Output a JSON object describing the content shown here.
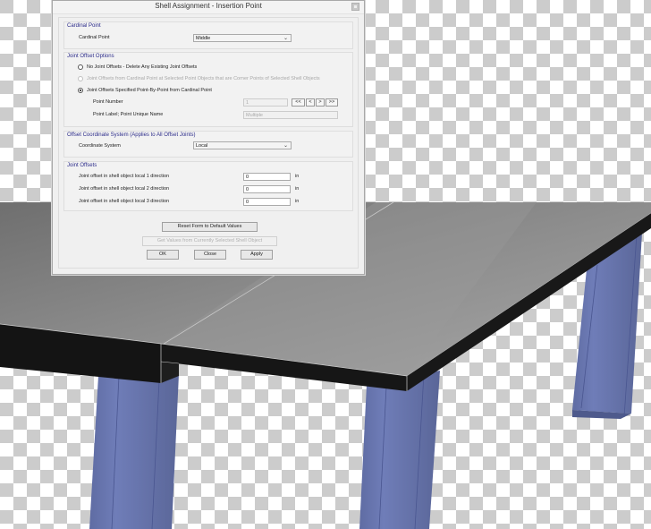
{
  "dialog": {
    "title": "Shell Assignment - Insertion Point",
    "close_icon": "close-icon",
    "cardinal_point": {
      "group_title": "Cardinal Point",
      "label": "Cardinal Point",
      "value": "Middle"
    },
    "joint_offset_options": {
      "group_title": "Joint Offset Options",
      "options": [
        {
          "label": "No Joint Offsets - Delete Any Existing Joint Offsets",
          "selected": false,
          "enabled": true
        },
        {
          "label": "Joint Offsets from Cardinal Point at Selected Point Objects that are Corner Points of Selected Shell Objects",
          "selected": false,
          "enabled": false
        },
        {
          "label": "Joint Offsets Specified Point-By-Point from Cardinal Point",
          "selected": true,
          "enabled": true
        }
      ],
      "point_number_label": "Point Number",
      "point_number_value": "1",
      "nav_buttons": [
        "<<",
        "<",
        ">",
        ">>"
      ],
      "point_label_label": "Point Label;  Point Unique Name",
      "point_label_value": "Multiple"
    },
    "offset_coordinate_system": {
      "group_title": "Offset Coordinate System  (Applies to All Offset Joints)",
      "label": "Coordinate System",
      "value": "Local"
    },
    "joint_offsets": {
      "group_title": "Joint Offsets",
      "rows": [
        {
          "label": "Joint offset in shell object local 1 direction",
          "value": "0",
          "unit": "in"
        },
        {
          "label": "Joint offset in shell object local 2 direction",
          "value": "0",
          "unit": "in"
        },
        {
          "label": "Joint offset in shell object local 3 direction",
          "value": "0",
          "unit": "in"
        }
      ]
    },
    "buttons": {
      "reset": "Reset Form to Default Values",
      "get_values": "Get Values from Currently Selected Shell Object",
      "ok": "OK",
      "close": "Close",
      "apply": "Apply"
    }
  },
  "scene": {
    "description": "3D model view of shell slab supported by columns",
    "slab_top_color": "#8e8e8e",
    "slab_edge_color": "#141414",
    "column_color": "#6a78b0"
  }
}
